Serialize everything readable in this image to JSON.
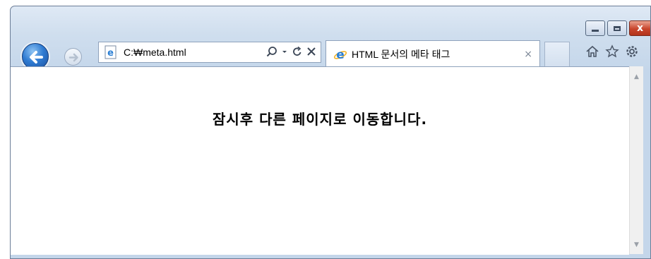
{
  "window": {
    "caption_buttons": [
      "minimize",
      "maximize",
      "close"
    ]
  },
  "nav": {
    "back_icon": "back-arrow-icon",
    "forward_icon": "forward-arrow-icon"
  },
  "address_bar": {
    "value": "C:₩meta.html",
    "icons": [
      "search-icon",
      "dropdown-icon",
      "refresh-icon",
      "stop-icon"
    ]
  },
  "tab": {
    "title": "HTML 문서의 메타 태그",
    "close": "×"
  },
  "command_icons": [
    "home-icon",
    "favorites-icon",
    "tools-icon"
  ],
  "page": {
    "message": "잠시후 다른 페이지로 이동합니다."
  },
  "colors": {
    "frame": "#cfdeee",
    "accent": "#2f7bd2",
    "close_button": "#c8452c"
  }
}
